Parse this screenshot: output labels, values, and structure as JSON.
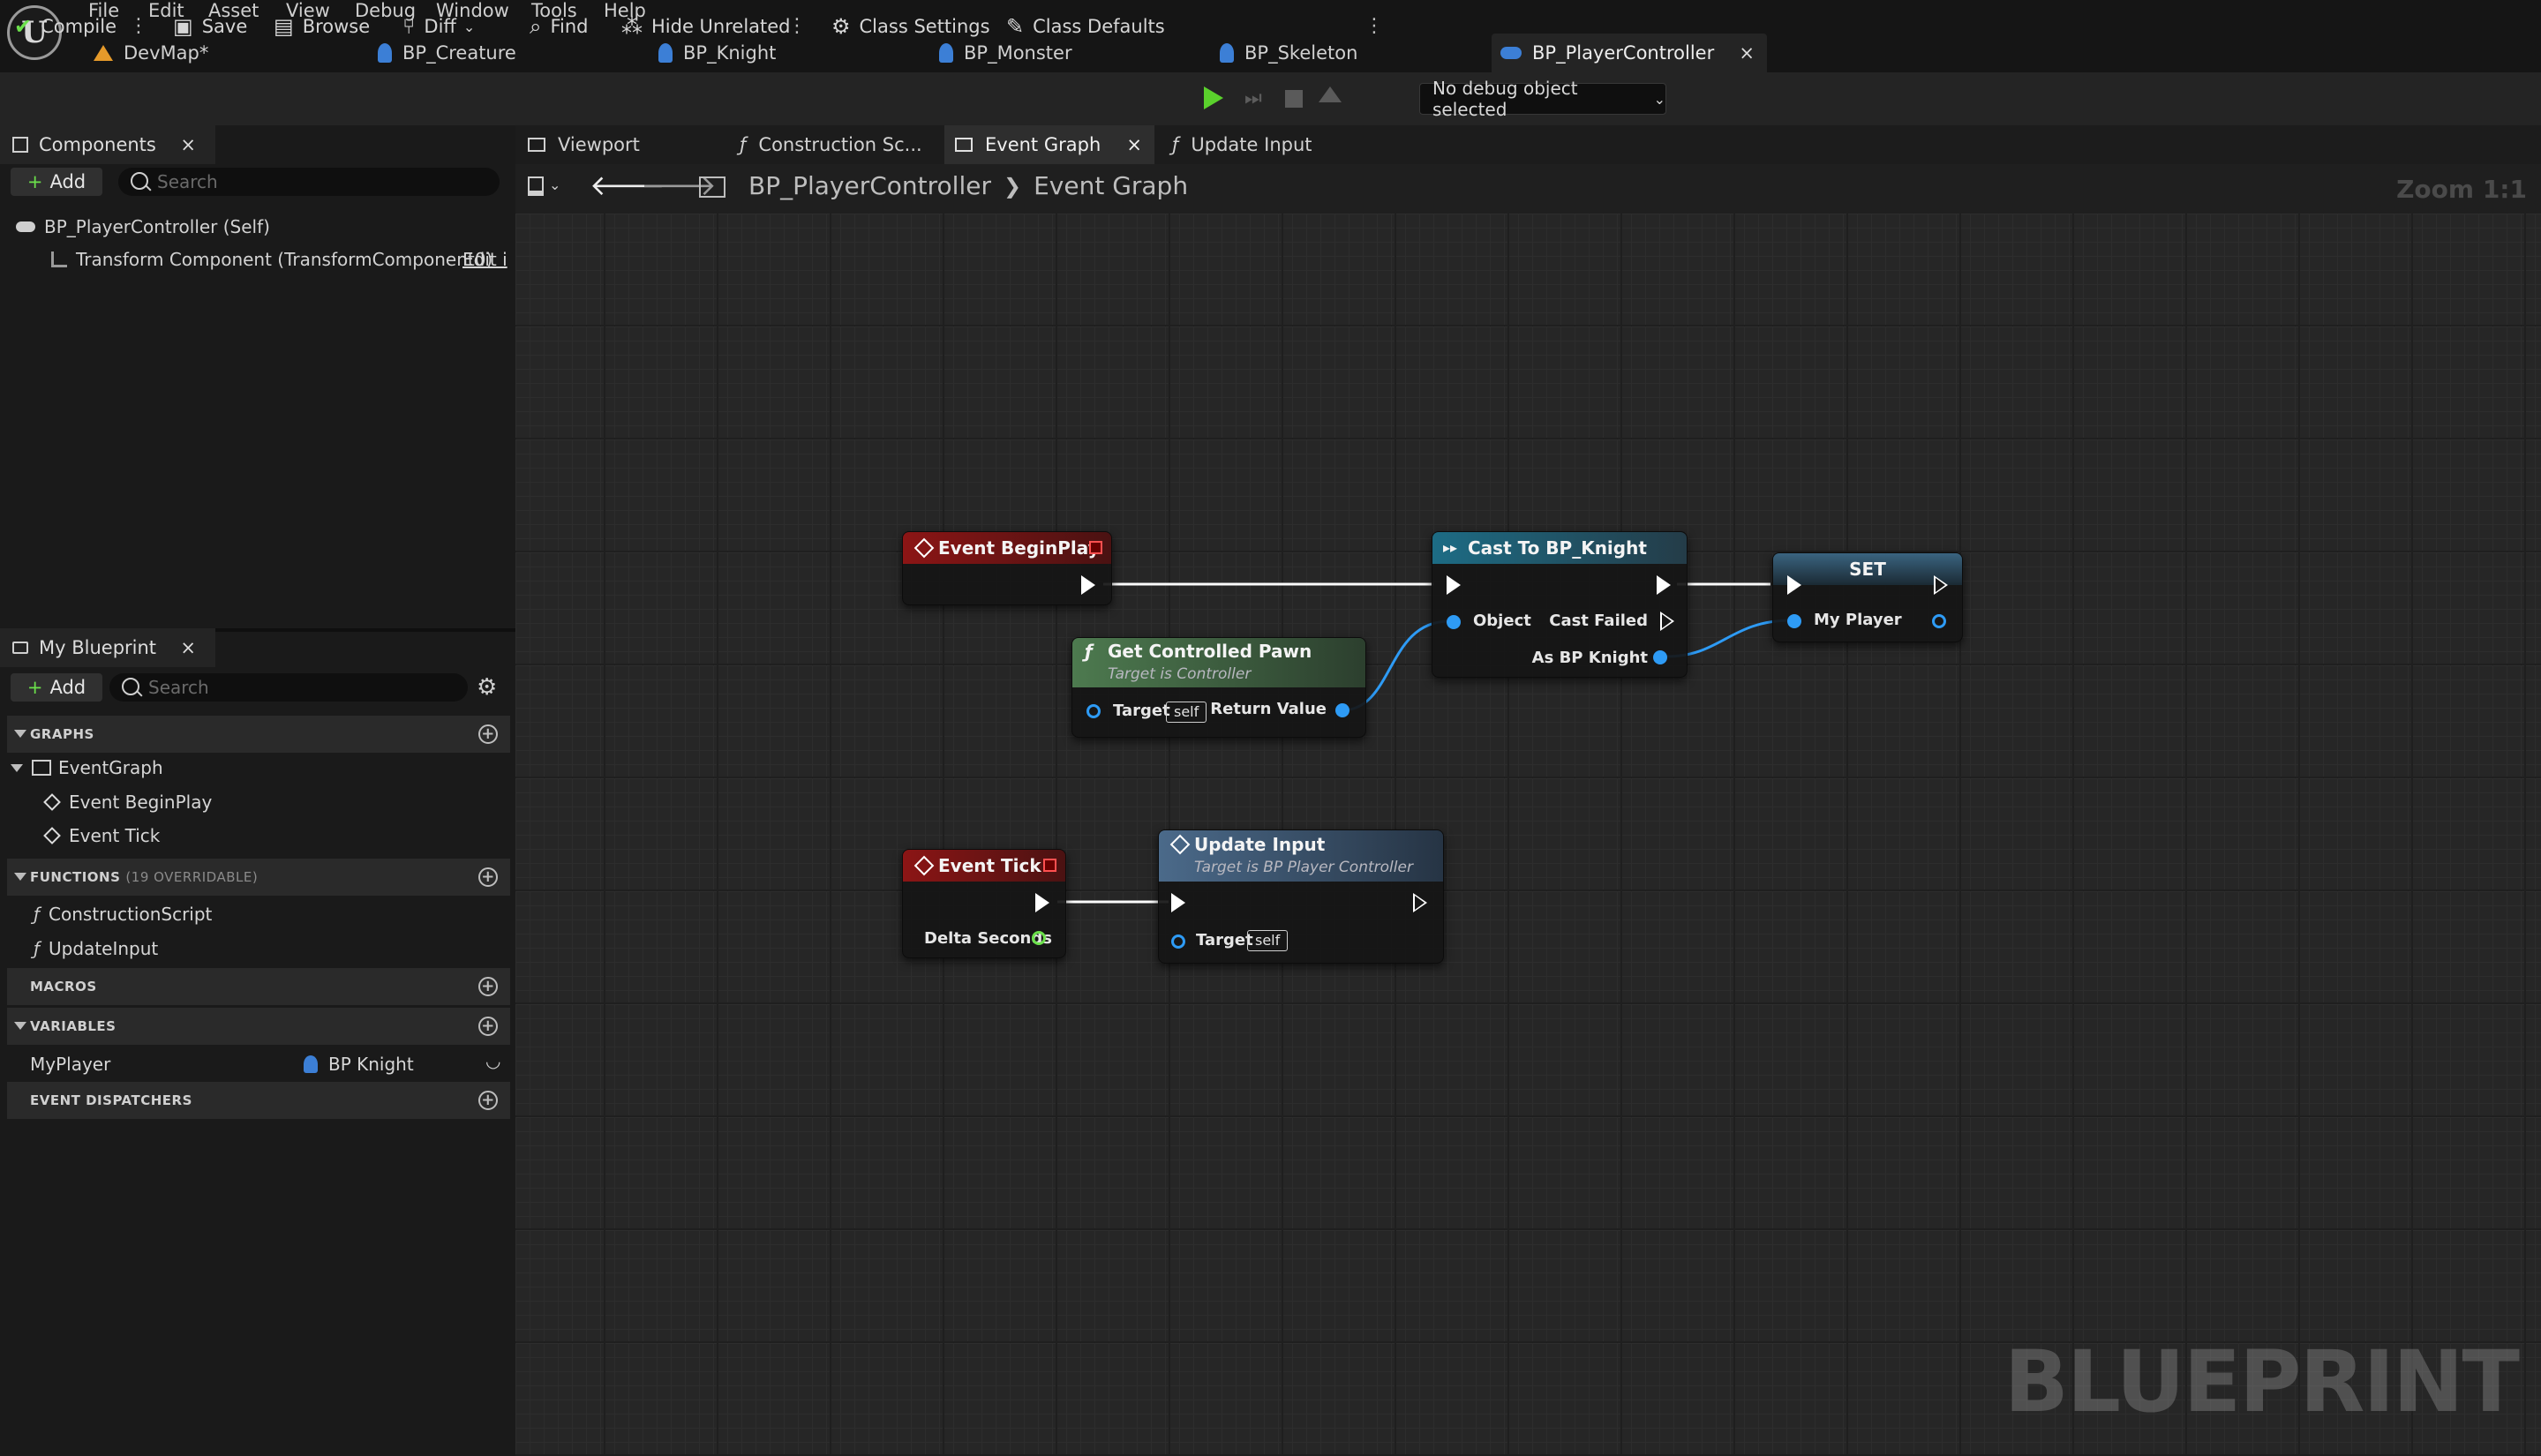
{
  "menu": [
    "File",
    "Edit",
    "Asset",
    "View",
    "Debug",
    "Window",
    "Tools",
    "Help"
  ],
  "doc_tabs": [
    "DevMap*",
    "BP_Creature",
    "BP_Knight",
    "BP_Monster",
    "BP_Skeleton",
    "BP_PlayerController"
  ],
  "doc_tab_close": "×",
  "toolbar": {
    "compile": "Compile",
    "save": "Save",
    "browse": "Browse",
    "diff": "Diff",
    "find": "Find",
    "hide_unrelated": "Hide Unrelated",
    "class_settings": "Class Settings",
    "class_defaults": "Class Defaults",
    "debug_object": "No debug object selected"
  },
  "components_panel": {
    "title": "Components",
    "add": "Add",
    "search_placeholder": "Search",
    "root": "BP_PlayerController (Self)",
    "child": "Transform Component (TransformComponent0)",
    "edit_link": "Edit i"
  },
  "my_blueprint": {
    "title": "My Blueprint",
    "add": "Add",
    "search_placeholder": "Search",
    "graphs_header": "GRAPHS",
    "event_graph": "EventGraph",
    "graph_items": [
      "Event BeginPlay",
      "Event Tick"
    ],
    "functions_header": "FUNCTIONS",
    "functions_sub": "(19 OVERRIDABLE)",
    "function_items": [
      "ConstructionScript",
      "UpdateInput"
    ],
    "macros_header": "MACROS",
    "variables_header": "VARIABLES",
    "variable_name": "MyPlayer",
    "variable_type": "BP Knight",
    "dispatchers_header": "EVENT DISPATCHERS"
  },
  "graph_tabs": [
    "Viewport",
    "Construction Sc...",
    "Event Graph",
    "Update Input"
  ],
  "breadcrumb": {
    "root": "BP_PlayerController",
    "current": "Event Graph"
  },
  "zoom": "Zoom 1:1",
  "watermark": "BLUEPRINT",
  "nodes": {
    "begin_play": {
      "title": "Event BeginPlay"
    },
    "cast": {
      "title": "Cast To BP_Knight",
      "object": "Object",
      "cast_failed": "Cast Failed",
      "as_knight": "As BP Knight"
    },
    "set": {
      "title": "SET",
      "my_player": "My Player"
    },
    "pawn": {
      "title": "Get Controlled Pawn",
      "subtitle": "Target is Controller",
      "target": "Target",
      "self": "self",
      "return": "Return Value"
    },
    "tick": {
      "title": "Event Tick",
      "delta": "Delta Seconds"
    },
    "update": {
      "title": "Update Input",
      "subtitle": "Target is BP Player Controller",
      "target": "Target",
      "self": "self"
    }
  },
  "colors": {
    "event_header": "#8a1a1a",
    "function_header": "#3f6b45",
    "cast_header": "#1f5a70",
    "set_header": "#2a4a60",
    "object_pin": "#2e9bf5",
    "float_pin": "#6be04b"
  }
}
